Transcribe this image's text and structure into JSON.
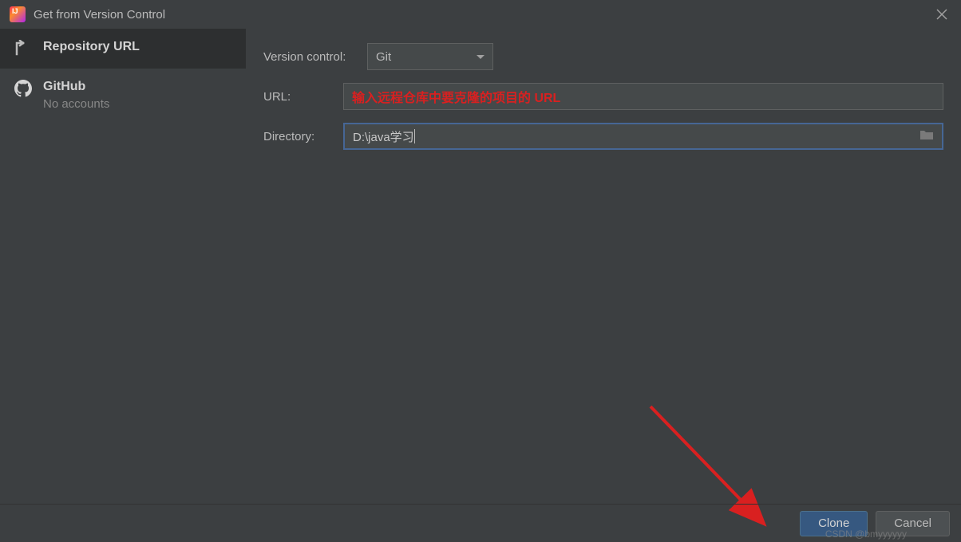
{
  "titlebar": {
    "title": "Get from Version Control"
  },
  "sidebar": {
    "items": [
      {
        "label": "Repository URL",
        "sublabel": ""
      },
      {
        "label": "GitHub",
        "sublabel": "No accounts"
      }
    ]
  },
  "form": {
    "version_control_label": "Version control:",
    "version_control_value": "Git",
    "url_label": "URL:",
    "url_annotation": "输入远程仓库中要克隆的项目的 URL",
    "directory_label": "Directory:",
    "directory_value": "D:\\java学习"
  },
  "buttons": {
    "clone": "Clone",
    "cancel": "Cancel"
  },
  "watermark": "CSDN @bmyyyyyy"
}
